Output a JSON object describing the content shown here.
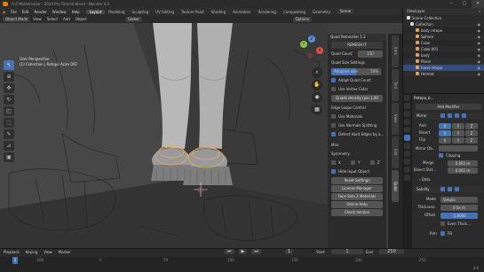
{
  "window": {
    "title": "A-Z Modelmaker - 2024 Pro Tutorial.blend - Blender 4.0",
    "controls": [
      "–",
      "□",
      "✕"
    ]
  },
  "menu": [
    "File",
    "Edit",
    "Render",
    "Window",
    "Help"
  ],
  "workspaces": [
    "Layout",
    "Modeling",
    "Sculpting",
    "UV Editing",
    "Texture Paint",
    "Shading",
    "Animation",
    "Rendering",
    "Compositing",
    "Geometry"
  ],
  "active_workspace": "Layout",
  "scene": {
    "label": "Scene",
    "view_layer": "ViewLayer"
  },
  "viewport_header": {
    "mode": "Object Mode",
    "menus": [
      "View",
      "Select",
      "Add",
      "Object"
    ],
    "transform": "Global",
    "options": "Options"
  },
  "overlay": {
    "line1": "User Perspective",
    "line2": "(1) Collection | Retopo Aciro 002"
  },
  "gizmo": {
    "x": "X",
    "y": "Y",
    "z": "Z"
  },
  "npanel": {
    "header": "Quad Remesher 1.2",
    "subtitle": "REMESH IT",
    "quad_count_label": "Quad Count",
    "quad_count_value": "150",
    "quad_size_settings": "Quad Size Settings",
    "adaptive_size_label": "Adaptive size",
    "adaptive_size_value": "50%",
    "adapt_quad_count": "Adapt Quad Count",
    "use_vertex_color": "Use Vertex Color",
    "quads_density": "Quads density (pai  1.00",
    "edge_loops_control": "Edge Loops Control",
    "use_materials": "Use Materials",
    "use_normals_splitting": "Use Normals Splitting",
    "detect_hard_edges": "Detect Hard Edges by a...",
    "misc": "Misc",
    "symmetry": "Symmetry",
    "axes": [
      "X",
      "Y",
      "Z"
    ],
    "hide_input_object": "Hide Input Object",
    "reset_settings": "Reset Settings",
    "license_manager": "License Manager",
    "face_sets": "Face Sets 2 Materials",
    "online_help": "Online Help",
    "check_version": "Check Version"
  },
  "ntabs": [
    "Item",
    "Tool",
    "View",
    "Edit",
    "Quad"
  ],
  "outliner": {
    "header": "Scene Collection",
    "items": [
      {
        "name": "Collection",
        "color": "#d0d0d0"
      },
      {
        "name": "body retopo",
        "color": "#e0a060"
      },
      {
        "name": "Sphere",
        "color": "#e0a060"
      },
      {
        "name": "Cube",
        "color": "#e0a060"
      },
      {
        "name": "Cube.001",
        "color": "#e0a060"
      },
      {
        "name": "body",
        "color": "#e0a060"
      },
      {
        "name": "Plane",
        "color": "#e0a060"
      },
      {
        "name": "hand retopo",
        "color": "#e0a060"
      },
      {
        "name": "Helmet",
        "color": "#e0a060"
      }
    ],
    "selected_index": 7
  },
  "properties": {
    "object_name": "Retopo_b...",
    "add_modifier": "Add Modifier",
    "mirror_header": "Mirror",
    "axis_label": "Axis",
    "bisect_label": "Bisect",
    "flip_label": "Flip",
    "axes": [
      "X",
      "Y",
      "Z"
    ],
    "mirror_object_label": "Mirror Ob...",
    "clipping": "Clipping",
    "merge_label": "Merge",
    "merge_value": "0.001 m",
    "bisect_distance_label": "Bisect Dist...",
    "bisect_distance_value": "0.001 m",
    "data_label": "Data",
    "solidify_header": "Solidify",
    "mode_label": "Mode",
    "mode_value": "Simple",
    "thickness_label": "Thickness",
    "thickness_value": "0.0x m",
    "offset_label": "Offset",
    "offset_value": "-1.0000",
    "even_thickness": "Even Thick...",
    "rim_label": "Rim",
    "fill": "Fill"
  },
  "timeline": {
    "playback": "Playback",
    "keying": "Keying",
    "view": "View",
    "marker": "Marker",
    "frame_current": "1",
    "start_label": "Start",
    "start_value": "1",
    "end_label": "End",
    "end_value": "250",
    "ticks": [
      "-100",
      "0",
      "50",
      "100",
      "150",
      "200",
      "250"
    ]
  },
  "statusbar": {
    "version": "4.0"
  },
  "colors": {
    "accent_blue": "#4772b3",
    "blender_orange": "#e87d0d",
    "selection_highlight": "#f0b060"
  },
  "icons": [
    "blender-logo-icon",
    "cursor-icon",
    "move-icon",
    "rotate-icon",
    "scale-icon",
    "transform-icon",
    "annotate-icon",
    "measure-icon",
    "add-cube-icon",
    "zoom-icon",
    "hand-icon",
    "camera-icon",
    "grid-icon",
    "eye-icon",
    "wrench-icon",
    "search-icon"
  ]
}
